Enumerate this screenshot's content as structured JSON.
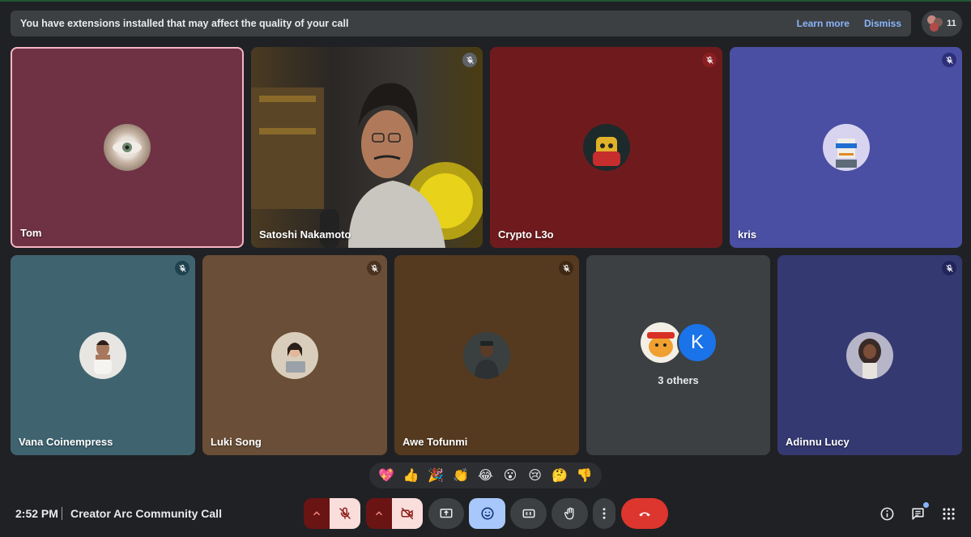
{
  "banner": {
    "message": "You have extensions installed that may affect the quality of your call",
    "learn_more": "Learn more",
    "dismiss": "Dismiss"
  },
  "participants_count": "11",
  "tiles": [
    {
      "name": "Tom",
      "muted": false,
      "color": "#7a3a4c"
    },
    {
      "name": "Satoshi Nakamoto",
      "muted": true,
      "color": "#3a3330"
    },
    {
      "name": "Crypto L3o",
      "muted": true,
      "color": "#7a1c1e"
    },
    {
      "name": "kris",
      "muted": true,
      "color": "#4b4fa3"
    },
    {
      "name": "Vana Coinempress",
      "muted": true,
      "color": "#3f6470"
    },
    {
      "name": "Luki Song",
      "muted": true,
      "color": "#6a4e37"
    },
    {
      "name": "Awe Tofunmi",
      "muted": true,
      "color": "#553a20"
    },
    {
      "name": "",
      "muted": false,
      "color": "#3c4043"
    },
    {
      "name": "Adinnu Lucy",
      "muted": true,
      "color": "#353972"
    }
  ],
  "others": {
    "label": "3 others",
    "initial": "K"
  },
  "reactions": [
    "💖",
    "👍",
    "🎉",
    "👏",
    "😂",
    "😮",
    "😢",
    "🤔",
    "👎"
  ],
  "footer": {
    "time": "2:52 PM",
    "meeting_title": "Creator Arc Community Call"
  },
  "colors": {
    "accent_blue": "#8ab4f8",
    "danger_red": "#ea4335",
    "muted_pink": "#f9dedc"
  }
}
